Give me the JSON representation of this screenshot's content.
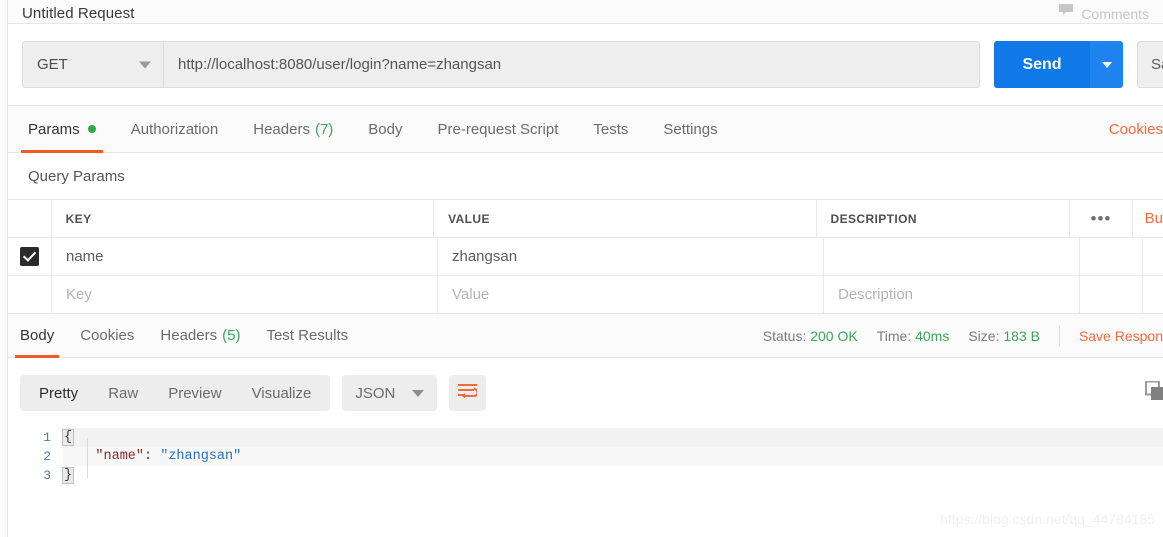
{
  "header": {
    "request_title": "Untitled Request",
    "comments_label": "Comments",
    "comments_icon": "comment-bubble-icon"
  },
  "url_bar": {
    "method": "GET",
    "method_caret_icon": "chevron-down-icon",
    "url": "http://localhost:8080/user/login?name=zhangsan",
    "send_label": "Send",
    "send_caret_icon": "chevron-down-icon",
    "save_label": "Save",
    "send_color": "#0f79e8"
  },
  "request_tabs": {
    "items": [
      {
        "label": "Params",
        "badge": "",
        "dot": true,
        "active": true
      },
      {
        "label": "Authorization",
        "badge": "",
        "dot": false,
        "active": false
      },
      {
        "label": "Headers",
        "badge": "(7)",
        "dot": false,
        "active": false
      },
      {
        "label": "Body",
        "badge": "",
        "dot": false,
        "active": false
      },
      {
        "label": "Pre-request Script",
        "badge": "",
        "dot": false,
        "active": false
      },
      {
        "label": "Tests",
        "badge": "",
        "dot": false,
        "active": false
      },
      {
        "label": "Settings",
        "badge": "",
        "dot": false,
        "active": false
      }
    ],
    "cookies_link": "Cookies",
    "active_underline_color": "#ef5b25",
    "badge_color": "#3fa45b"
  },
  "query_params": {
    "section_label": "Query Params",
    "columns": [
      "KEY",
      "VALUE",
      "DESCRIPTION"
    ],
    "more_icon": "ellipsis-icon",
    "bulk_edit_label": "Bu",
    "rows": [
      {
        "checked": true,
        "key": "name",
        "value": "zhangsan",
        "description": ""
      }
    ],
    "placeholder_row": {
      "key": "Key",
      "value": "Value",
      "description": "Description"
    }
  },
  "response_tabs": {
    "items": [
      {
        "label": "Body",
        "badge": "",
        "active": true
      },
      {
        "label": "Cookies",
        "badge": "",
        "active": false
      },
      {
        "label": "Headers",
        "badge": "(5)",
        "active": false
      },
      {
        "label": "Test Results",
        "badge": "",
        "active": false
      }
    ],
    "status_label": "Status:",
    "status_value": "200 OK",
    "time_label": "Time:",
    "time_value": "40ms",
    "size_label": "Size:",
    "size_value": "183 B",
    "save_response_label": "Save Respon",
    "value_color": "#3fa45b"
  },
  "response_toolbar": {
    "view_modes": [
      "Pretty",
      "Raw",
      "Preview",
      "Visualize"
    ],
    "active_view": "Pretty",
    "format": "JSON",
    "format_caret_icon": "chevron-down-icon",
    "wrap_icon": "word-wrap-icon",
    "copy_icon": "copy-icon"
  },
  "response_body": {
    "lines": [
      {
        "num": "1",
        "open_brace": "{"
      },
      {
        "num": "2",
        "key": "\"name\"",
        "colon": ": ",
        "value": "\"zhangsan\""
      },
      {
        "num": "3",
        "close_brace": "}"
      }
    ]
  },
  "watermark": "https://blog.csdn.net/qq_44784185"
}
